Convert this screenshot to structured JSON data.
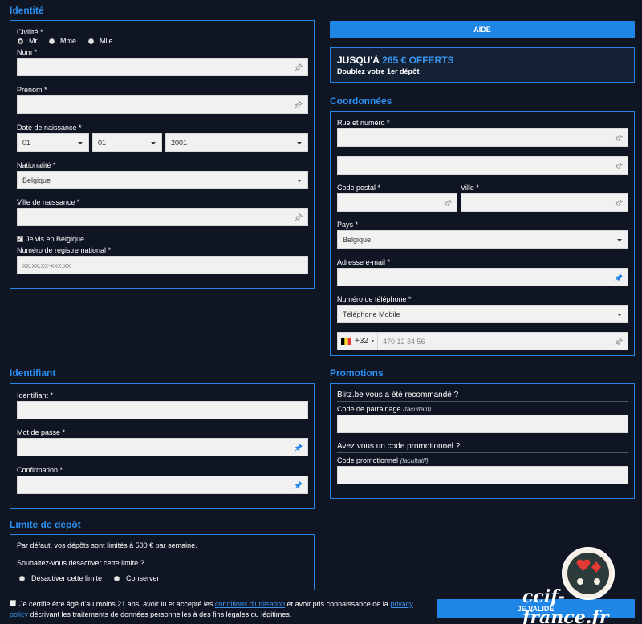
{
  "identite": {
    "title": "Identité",
    "civilite_label": "Civilité *",
    "civilite_options": [
      "Mr",
      "Mme",
      "Mlle"
    ],
    "nom_label": "Nom *",
    "prenom_label": "Prénom *",
    "dob_label": "Date de naissance *",
    "dob_day": "01",
    "dob_month": "01",
    "dob_year": "2001",
    "nationalite_label": "Nationalité *",
    "nationalite_value": "Belgique",
    "ville_naissance_label": "Ville de naissance *",
    "vis_belgique_label": "Je vis en Belgique",
    "registre_label": "Numéro de registre national *",
    "registre_placeholder": "xx.xx.xx-xxx.xx"
  },
  "aide_button": "AIDE",
  "bonus": {
    "prefix": "JUSQU'À ",
    "amount": "265 € OFFERTS",
    "subtitle": "Doublez votre 1er dépôt"
  },
  "coordonnees": {
    "title": "Coordonnées",
    "rue_label": "Rue et numéro *",
    "code_postal_label": "Code postal *",
    "ville_label": "Ville *",
    "pays_label": "Pays *",
    "pays_value": "Belgique",
    "email_label": "Adresse e-mail *",
    "tel_label": "Numéro de téléphone *",
    "tel_type": "Téléphone Mobile",
    "tel_prefix": "+32",
    "tel_placeholder": "470 12 34 56"
  },
  "identifiant": {
    "title": "Identifiant",
    "identifiant_label": "Identifiant *",
    "password_label": "Mot de passe *",
    "confirmation_label": "Confirmation *"
  },
  "promotions": {
    "title": "Promotions",
    "recommande_q": "Blitz.be vous a été recommandé ?",
    "parrainage_label": "Code de parrainage",
    "promo_q": "Avez vous un code promotionnel ?",
    "promo_label": "Code promotionnel",
    "optional": "(facultatif)"
  },
  "limite": {
    "title": "Limite de dépôt",
    "info": "Par défaut, vos dépôts sont limités à 500 € par semaine.",
    "question": "Souhaitez-vous désactiver cette limite ?",
    "opt_disable": "Désactiver cette limite",
    "opt_keep": "Conserver"
  },
  "terms": {
    "part1": "Je certifie être âgé d'au moins 21 ans, avoir lu et accepté les ",
    "link1": "conditions d'utilisation",
    "part2": " et avoir pris connaissance de la ",
    "link2a": "privacy",
    "link2b": "policy",
    "part3": " décrivant les traitements de données personnelles à des fins légales ou légitimes."
  },
  "submit_button": "JE VALIDE",
  "watermark": "ccif-france.fr",
  "colors": {
    "background": "#0f1522",
    "accent": "#2585e6",
    "bonus_amount": "#3a95f0"
  }
}
